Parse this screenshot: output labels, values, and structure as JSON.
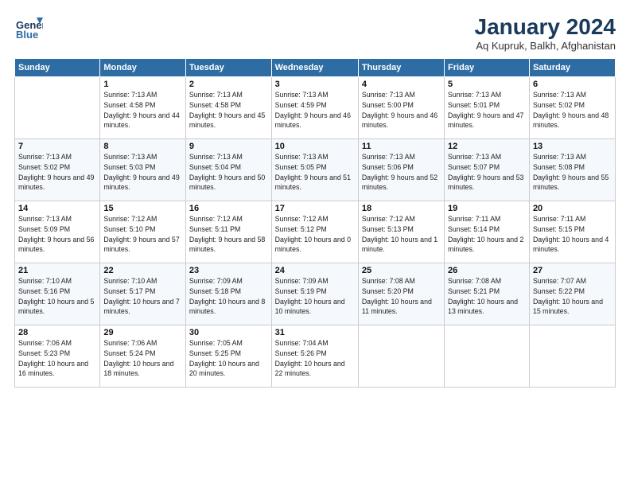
{
  "logo": {
    "line1": "General",
    "line2": "Blue"
  },
  "title": "January 2024",
  "subtitle": "Aq Kupruk, Balkh, Afghanistan",
  "weekdays": [
    "Sunday",
    "Monday",
    "Tuesday",
    "Wednesday",
    "Thursday",
    "Friday",
    "Saturday"
  ],
  "weeks": [
    [
      {
        "day": "",
        "sunrise": "",
        "sunset": "",
        "daylight": ""
      },
      {
        "day": "1",
        "sunrise": "Sunrise: 7:13 AM",
        "sunset": "Sunset: 4:58 PM",
        "daylight": "Daylight: 9 hours and 44 minutes."
      },
      {
        "day": "2",
        "sunrise": "Sunrise: 7:13 AM",
        "sunset": "Sunset: 4:58 PM",
        "daylight": "Daylight: 9 hours and 45 minutes."
      },
      {
        "day": "3",
        "sunrise": "Sunrise: 7:13 AM",
        "sunset": "Sunset: 4:59 PM",
        "daylight": "Daylight: 9 hours and 46 minutes."
      },
      {
        "day": "4",
        "sunrise": "Sunrise: 7:13 AM",
        "sunset": "Sunset: 5:00 PM",
        "daylight": "Daylight: 9 hours and 46 minutes."
      },
      {
        "day": "5",
        "sunrise": "Sunrise: 7:13 AM",
        "sunset": "Sunset: 5:01 PM",
        "daylight": "Daylight: 9 hours and 47 minutes."
      },
      {
        "day": "6",
        "sunrise": "Sunrise: 7:13 AM",
        "sunset": "Sunset: 5:02 PM",
        "daylight": "Daylight: 9 hours and 48 minutes."
      }
    ],
    [
      {
        "day": "7",
        "sunrise": "Sunrise: 7:13 AM",
        "sunset": "Sunset: 5:02 PM",
        "daylight": "Daylight: 9 hours and 49 minutes."
      },
      {
        "day": "8",
        "sunrise": "Sunrise: 7:13 AM",
        "sunset": "Sunset: 5:03 PM",
        "daylight": "Daylight: 9 hours and 49 minutes."
      },
      {
        "day": "9",
        "sunrise": "Sunrise: 7:13 AM",
        "sunset": "Sunset: 5:04 PM",
        "daylight": "Daylight: 9 hours and 50 minutes."
      },
      {
        "day": "10",
        "sunrise": "Sunrise: 7:13 AM",
        "sunset": "Sunset: 5:05 PM",
        "daylight": "Daylight: 9 hours and 51 minutes."
      },
      {
        "day": "11",
        "sunrise": "Sunrise: 7:13 AM",
        "sunset": "Sunset: 5:06 PM",
        "daylight": "Daylight: 9 hours and 52 minutes."
      },
      {
        "day": "12",
        "sunrise": "Sunrise: 7:13 AM",
        "sunset": "Sunset: 5:07 PM",
        "daylight": "Daylight: 9 hours and 53 minutes."
      },
      {
        "day": "13",
        "sunrise": "Sunrise: 7:13 AM",
        "sunset": "Sunset: 5:08 PM",
        "daylight": "Daylight: 9 hours and 55 minutes."
      }
    ],
    [
      {
        "day": "14",
        "sunrise": "Sunrise: 7:13 AM",
        "sunset": "Sunset: 5:09 PM",
        "daylight": "Daylight: 9 hours and 56 minutes."
      },
      {
        "day": "15",
        "sunrise": "Sunrise: 7:12 AM",
        "sunset": "Sunset: 5:10 PM",
        "daylight": "Daylight: 9 hours and 57 minutes."
      },
      {
        "day": "16",
        "sunrise": "Sunrise: 7:12 AM",
        "sunset": "Sunset: 5:11 PM",
        "daylight": "Daylight: 9 hours and 58 minutes."
      },
      {
        "day": "17",
        "sunrise": "Sunrise: 7:12 AM",
        "sunset": "Sunset: 5:12 PM",
        "daylight": "Daylight: 10 hours and 0 minutes."
      },
      {
        "day": "18",
        "sunrise": "Sunrise: 7:12 AM",
        "sunset": "Sunset: 5:13 PM",
        "daylight": "Daylight: 10 hours and 1 minute."
      },
      {
        "day": "19",
        "sunrise": "Sunrise: 7:11 AM",
        "sunset": "Sunset: 5:14 PM",
        "daylight": "Daylight: 10 hours and 2 minutes."
      },
      {
        "day": "20",
        "sunrise": "Sunrise: 7:11 AM",
        "sunset": "Sunset: 5:15 PM",
        "daylight": "Daylight: 10 hours and 4 minutes."
      }
    ],
    [
      {
        "day": "21",
        "sunrise": "Sunrise: 7:10 AM",
        "sunset": "Sunset: 5:16 PM",
        "daylight": "Daylight: 10 hours and 5 minutes."
      },
      {
        "day": "22",
        "sunrise": "Sunrise: 7:10 AM",
        "sunset": "Sunset: 5:17 PM",
        "daylight": "Daylight: 10 hours and 7 minutes."
      },
      {
        "day": "23",
        "sunrise": "Sunrise: 7:09 AM",
        "sunset": "Sunset: 5:18 PM",
        "daylight": "Daylight: 10 hours and 8 minutes."
      },
      {
        "day": "24",
        "sunrise": "Sunrise: 7:09 AM",
        "sunset": "Sunset: 5:19 PM",
        "daylight": "Daylight: 10 hours and 10 minutes."
      },
      {
        "day": "25",
        "sunrise": "Sunrise: 7:08 AM",
        "sunset": "Sunset: 5:20 PM",
        "daylight": "Daylight: 10 hours and 11 minutes."
      },
      {
        "day": "26",
        "sunrise": "Sunrise: 7:08 AM",
        "sunset": "Sunset: 5:21 PM",
        "daylight": "Daylight: 10 hours and 13 minutes."
      },
      {
        "day": "27",
        "sunrise": "Sunrise: 7:07 AM",
        "sunset": "Sunset: 5:22 PM",
        "daylight": "Daylight: 10 hours and 15 minutes."
      }
    ],
    [
      {
        "day": "28",
        "sunrise": "Sunrise: 7:06 AM",
        "sunset": "Sunset: 5:23 PM",
        "daylight": "Daylight: 10 hours and 16 minutes."
      },
      {
        "day": "29",
        "sunrise": "Sunrise: 7:06 AM",
        "sunset": "Sunset: 5:24 PM",
        "daylight": "Daylight: 10 hours and 18 minutes."
      },
      {
        "day": "30",
        "sunrise": "Sunrise: 7:05 AM",
        "sunset": "Sunset: 5:25 PM",
        "daylight": "Daylight: 10 hours and 20 minutes."
      },
      {
        "day": "31",
        "sunrise": "Sunrise: 7:04 AM",
        "sunset": "Sunset: 5:26 PM",
        "daylight": "Daylight: 10 hours and 22 minutes."
      },
      {
        "day": "",
        "sunrise": "",
        "sunset": "",
        "daylight": ""
      },
      {
        "day": "",
        "sunrise": "",
        "sunset": "",
        "daylight": ""
      },
      {
        "day": "",
        "sunrise": "",
        "sunset": "",
        "daylight": ""
      }
    ]
  ]
}
